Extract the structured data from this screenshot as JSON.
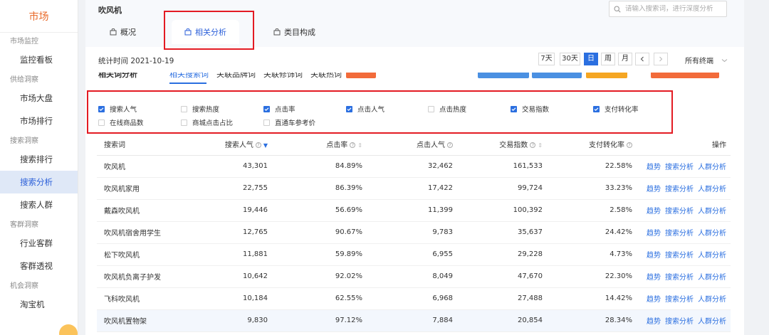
{
  "sidebar": {
    "brand": "市场",
    "sections": [
      {
        "title": "市场监控",
        "items": [
          {
            "label": "监控看板"
          }
        ]
      },
      {
        "title": "供给洞察",
        "items": [
          {
            "label": "市场大盘"
          },
          {
            "label": "市场排行"
          }
        ]
      },
      {
        "title": "搜索洞察",
        "items": [
          {
            "label": "搜索排行"
          },
          {
            "label": "搜索分析",
            "active": true
          },
          {
            "label": "搜索人群"
          }
        ]
      },
      {
        "title": "客群洞察",
        "items": [
          {
            "label": "行业客群"
          },
          {
            "label": "客群透视"
          }
        ]
      },
      {
        "title": "机会洞察",
        "items": [
          {
            "label": "淘宝机"
          }
        ]
      }
    ]
  },
  "header": {
    "keyword": "吹风机",
    "search_placeholder": "请输入搜索词，进行深度分析",
    "tabs": [
      {
        "label": "概况"
      },
      {
        "label": "相关分析",
        "active": true
      },
      {
        "label": "类目构成"
      }
    ],
    "stat_time": "统计时间 2021-10-19",
    "ranges": [
      "7天",
      "30天",
      "日",
      "周",
      "月"
    ],
    "active_range": "日",
    "terminal": "所有终端"
  },
  "subtabs": {
    "title": "相关词分析",
    "items": [
      "相关搜索词",
      "关联品牌词",
      "关联修饰词",
      "关联热词"
    ]
  },
  "filters": [
    {
      "label": "搜索人气",
      "checked": true
    },
    {
      "label": "搜索热度",
      "checked": false
    },
    {
      "label": "点击率",
      "checked": true
    },
    {
      "label": "点击人气",
      "checked": true
    },
    {
      "label": "点击热度",
      "checked": false
    },
    {
      "label": "交易指数",
      "checked": true
    },
    {
      "label": "支付转化率",
      "checked": true
    },
    {
      "label": "在线商品数",
      "checked": false
    },
    {
      "label": "商城点击占比",
      "checked": false
    },
    {
      "label": "直通车参考价",
      "checked": false
    }
  ],
  "table": {
    "headers": [
      "搜索词",
      "搜索人气",
      "点击率",
      "点击人气",
      "交易指数",
      "支付转化率",
      "操作"
    ],
    "actions": [
      "趋势",
      "搜索分析",
      "人群分析"
    ],
    "rows": [
      [
        "吹风机",
        "43,301",
        "84.89%",
        "32,462",
        "161,533",
        "22.58%"
      ],
      [
        "吹风机家用",
        "22,755",
        "86.39%",
        "17,422",
        "99,724",
        "33.23%"
      ],
      [
        "戴森吹风机",
        "19,446",
        "56.69%",
        "11,399",
        "100,392",
        "2.58%"
      ],
      [
        "吹风机宿舍用学生",
        "12,765",
        "90.67%",
        "9,783",
        "35,637",
        "24.42%"
      ],
      [
        "松下吹风机",
        "11,881",
        "59.89%",
        "6,955",
        "29,228",
        "4.73%"
      ],
      [
        "吹风机负离子护发",
        "10,642",
        "92.02%",
        "8,049",
        "47,670",
        "22.30%"
      ],
      [
        "飞科吹风机",
        "10,184",
        "62.55%",
        "6,968",
        "27,488",
        "14.42%"
      ],
      [
        "吹风机置物架",
        "9,830",
        "97.12%",
        "7,884",
        "20,854",
        "28.34%"
      ]
    ]
  },
  "colors": {
    "accent": "#2b6fe0",
    "highlight": "#e31b23",
    "brand": "#e96a2a"
  }
}
